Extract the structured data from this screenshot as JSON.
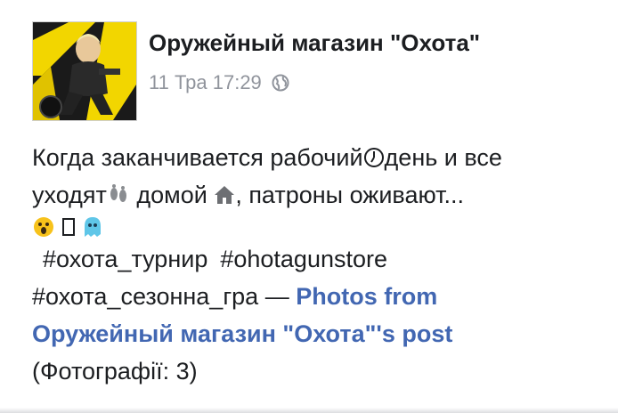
{
  "post": {
    "page_name": "Оружейный магазин \"Охота\"",
    "timestamp": "11 Тра 17:29",
    "audience_icon": "globe-icon",
    "text": {
      "line1_a": "Когда заканчивается рабочий",
      "line1_b": " день и все",
      "line2_a": "уходят",
      "line2_b": " домой ",
      "line2_c": ", патроны оживают...",
      "hashtag1": "#охота_турнир",
      "hashtag2": "#ohotagunstore",
      "hashtag3": "#охота_сезонна_гра",
      "dash": " — ",
      "link_part1": "Photos from",
      "link_part2": "Оружейный магазин \"Охота\"'s post",
      "photo_count": "(Фотографії: 3)"
    },
    "icons": [
      "clock-icon",
      "footprints-icon",
      "house-icon",
      "scared-face-icon",
      "box-glyph-icon",
      "ghost-icon"
    ],
    "colors": {
      "link": "#385898",
      "meta": "#90949c",
      "text": "#1c1e21",
      "avatar_accent": "#f5d400"
    }
  }
}
